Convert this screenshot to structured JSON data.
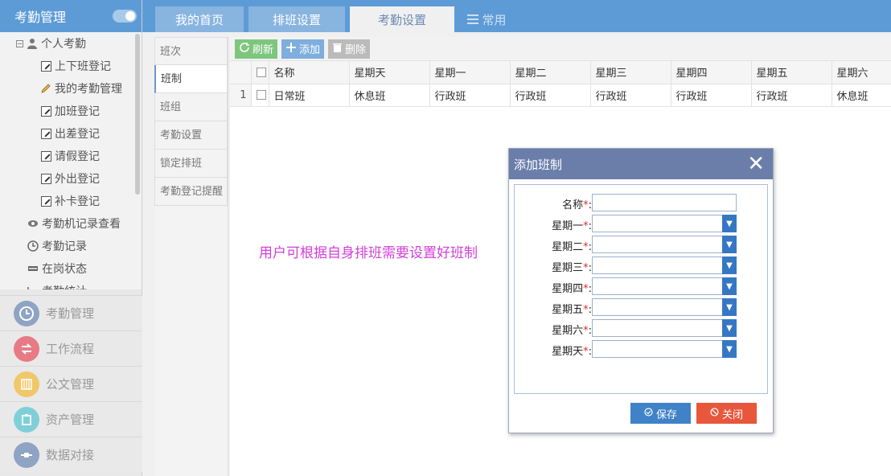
{
  "sidebar": {
    "title": "考勤管理",
    "tree": {
      "root": "个人考勤",
      "items": [
        "上下班登记",
        "我的考勤管理",
        "加班登记",
        "出差登记",
        "请假登记",
        "外出登记",
        "补卡登记"
      ],
      "siblings": [
        "考勤机记录查看",
        "考勤记录",
        "在岗状态",
        "考勤统计"
      ]
    },
    "modules": [
      {
        "label": "考勤管理",
        "color": "#8fa3c4"
      },
      {
        "label": "工作流程",
        "color": "#e87a86"
      },
      {
        "label": "公文管理",
        "color": "#f0c86a"
      },
      {
        "label": "资产管理",
        "color": "#7fcfd9"
      },
      {
        "label": "数据对接",
        "color": "#8fa3c4"
      }
    ]
  },
  "tabs": [
    "我的首页",
    "排班设置",
    "考勤设置",
    "常用"
  ],
  "inner_menu": [
    "班次",
    "班制",
    "班组",
    "考勤设置",
    "锁定排班",
    "考勤登记提醒"
  ],
  "toolbar": {
    "refresh": "刷新",
    "add": "添加",
    "delete": "删除"
  },
  "table": {
    "headers": [
      "名称",
      "星期天",
      "星期一",
      "星期二",
      "星期三",
      "星期四",
      "星期五",
      "星期六"
    ],
    "rows": [
      {
        "num": "1",
        "cells": [
          "日常班",
          "休息班",
          "行政班",
          "行政班",
          "行政班",
          "行政班",
          "行政班",
          "休息班"
        ]
      }
    ]
  },
  "note": "用户可根据自身排班需要设置好班制",
  "dialog": {
    "title": "添加班制",
    "fields": [
      "名称",
      "星期一",
      "星期二",
      "星期三",
      "星期四",
      "星期五",
      "星期六",
      "星期天"
    ],
    "required_mark": "*",
    "colon": ":",
    "save": "保存",
    "close": "关闭"
  }
}
